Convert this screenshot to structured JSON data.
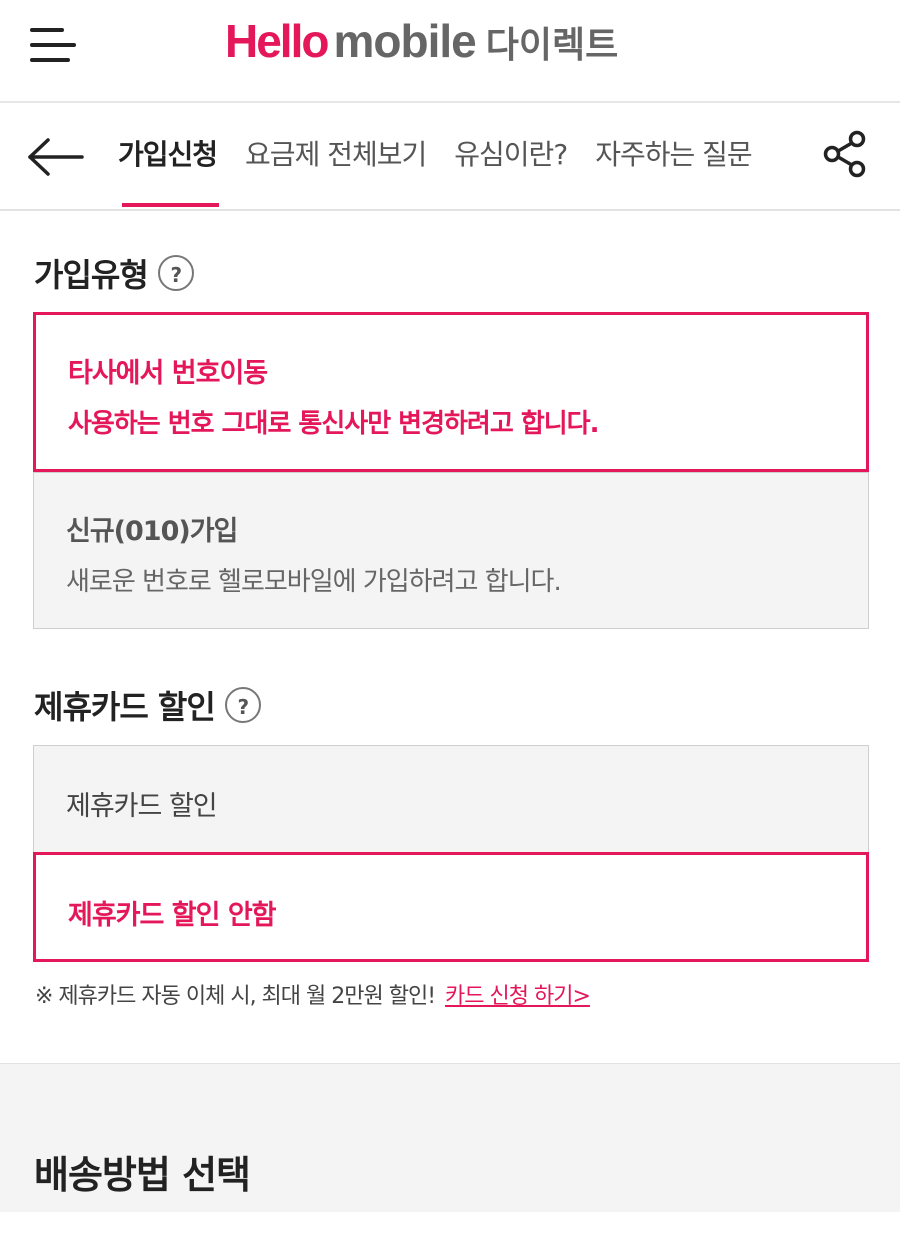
{
  "header": {
    "logo_hello": "Hello",
    "logo_mobile": "mobile",
    "logo_direct": "다이렉트",
    "brand_color": "#e4175b"
  },
  "tabs": [
    {
      "label": "가입신청",
      "active": true
    },
    {
      "label": "요금제 전체보기",
      "active": false
    },
    {
      "label": "유심이란?",
      "active": false
    },
    {
      "label": "자주하는 질문",
      "active": false
    }
  ],
  "join_type": {
    "title": "가입유형",
    "help_icon": "?",
    "options": [
      {
        "title": "타사에서 번호이동",
        "desc": "사용하는 번호 그대로 통신사만 변경하려고 합니다.",
        "selected": true
      },
      {
        "title": "신규(010)가입",
        "desc": "새로운 번호로 헬로모바일에 가입하려고 합니다.",
        "selected": false
      }
    ]
  },
  "card_discount": {
    "title": "제휴카드 할인",
    "help_icon": "?",
    "options": [
      {
        "label": "제휴카드 할인",
        "selected": false
      },
      {
        "label": "제휴카드 할인 안함",
        "selected": true
      }
    ],
    "note": "※ 제휴카드 자동 이체 시, 최대 월 2만원 할인!",
    "link": "카드 신청 하기>"
  },
  "delivery": {
    "title": "배송방법 선택"
  }
}
